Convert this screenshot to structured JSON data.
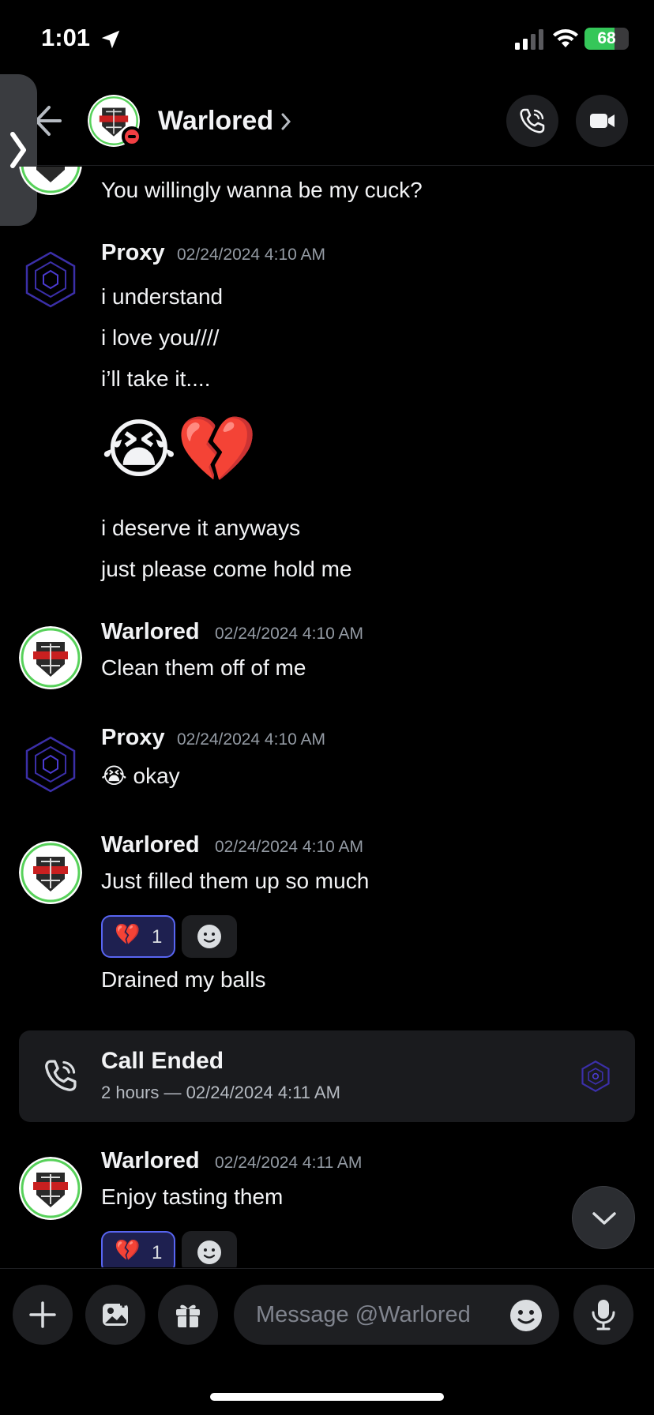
{
  "status_bar": {
    "time": "1:01",
    "battery_percent": "68",
    "battery_level": 0.68,
    "icons": [
      "location-arrow-icon",
      "cellular-signal-icon",
      "wifi-icon",
      "battery-charging-icon"
    ]
  },
  "header": {
    "name": "Warlored",
    "status": "do-not-disturb",
    "icons": [
      "back-arrow-icon",
      "chevron-right-icon",
      "voice-call-icon",
      "video-call-icon"
    ]
  },
  "messages": [
    {
      "id": "m0",
      "author": "",
      "lines": [
        "You willingly wanna be my cuck?"
      ]
    },
    {
      "id": "m1",
      "author": "Proxy",
      "timestamp": "02/24/2024 4:10 AM",
      "lines": [
        "i understand",
        "i love you////",
        "i’ll take it...."
      ],
      "emoji_line": "😭💔",
      "lines_after": [
        "i deserve it anyways",
        "just please come hold me"
      ]
    },
    {
      "id": "m2",
      "author": "Warlored",
      "timestamp": "02/24/2024 4:10 AM",
      "lines": [
        "Clean them off of me"
      ]
    },
    {
      "id": "m3",
      "author": "Proxy",
      "timestamp": "02/24/2024 4:10 AM",
      "emoji": "😭",
      "text": "okay"
    },
    {
      "id": "m4",
      "author": "Warlored",
      "timestamp": "02/24/2024 4:10 AM",
      "lines": [
        "Just filled them up so much"
      ],
      "reaction": {
        "emoji": "💔",
        "count": "1"
      },
      "lines_after": [
        "Drained my balls"
      ]
    },
    {
      "id": "m5",
      "author": "Warlored",
      "timestamp": "02/24/2024 4:11 AM",
      "lines": [
        "Enjoy tasting them"
      ],
      "reaction": {
        "emoji": "💔",
        "count": "1"
      }
    }
  ],
  "call": {
    "title": "Call Ended",
    "subtitle": "2 hours — 02/24/2024 4:11 AM"
  },
  "input": {
    "placeholder": "Message @Warlored"
  },
  "colors": {
    "background": "#000000",
    "surface": "#1e1f22",
    "accent": "#5865f2",
    "dnd": "#f23f43",
    "battery": "#35c759",
    "timestamp": "#949ba4"
  }
}
